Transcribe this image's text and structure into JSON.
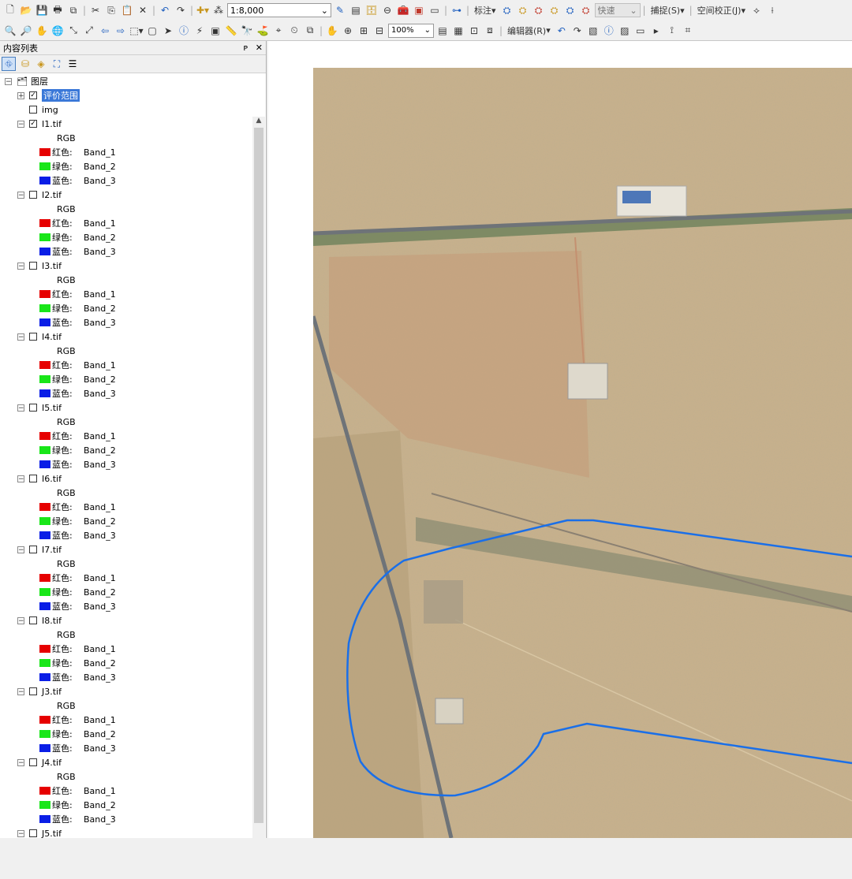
{
  "toolbar1": {
    "scale_value": "1:8,000",
    "label_menu": "标注",
    "speed_value": "快速",
    "snap_menu": "捕捉(S)",
    "georef_menu": "空间校正(J)"
  },
  "toolbar2": {
    "zoom_value": "100%",
    "editor_menu": "编辑器(R)"
  },
  "toc": {
    "title": "内容列表",
    "pin_glyph": "ᴘ",
    "close_glyph": "✕",
    "root_label": "图层",
    "items": [
      {
        "label": "评价范围",
        "checked": true,
        "selected": true,
        "expand": "+"
      },
      {
        "label": "img",
        "checked": false
      },
      {
        "label": "I1.tif",
        "checked": true,
        "expand": "−",
        "rgb": "RGB",
        "bands": [
          {
            "name": "红色:",
            "band": "Band_1"
          },
          {
            "name": "绿色:",
            "band": "Band_2"
          },
          {
            "name": "蓝色:",
            "band": "Band_3"
          }
        ]
      },
      {
        "label": "I2.tif",
        "checked": false,
        "expand": "−",
        "rgb": "RGB",
        "bands": [
          {
            "name": "红色:",
            "band": "Band_1"
          },
          {
            "name": "绿色:",
            "band": "Band_2"
          },
          {
            "name": "蓝色:",
            "band": "Band_3"
          }
        ]
      },
      {
        "label": "I3.tif",
        "checked": false,
        "expand": "−",
        "rgb": "RGB",
        "bands": [
          {
            "name": "红色:",
            "band": "Band_1"
          },
          {
            "name": "绿色:",
            "band": "Band_2"
          },
          {
            "name": "蓝色:",
            "band": "Band_3"
          }
        ]
      },
      {
        "label": "I4.tif",
        "checked": false,
        "expand": "−",
        "rgb": "RGB",
        "bands": [
          {
            "name": "红色:",
            "band": "Band_1"
          },
          {
            "name": "绿色:",
            "band": "Band_2"
          },
          {
            "name": "蓝色:",
            "band": "Band_3"
          }
        ]
      },
      {
        "label": "I5.tif",
        "checked": false,
        "expand": "−",
        "rgb": "RGB",
        "bands": [
          {
            "name": "红色:",
            "band": "Band_1"
          },
          {
            "name": "绿色:",
            "band": "Band_2"
          },
          {
            "name": "蓝色:",
            "band": "Band_3"
          }
        ]
      },
      {
        "label": "I6.tif",
        "checked": false,
        "expand": "−",
        "rgb": "RGB",
        "bands": [
          {
            "name": "红色:",
            "band": "Band_1"
          },
          {
            "name": "绿色:",
            "band": "Band_2"
          },
          {
            "name": "蓝色:",
            "band": "Band_3"
          }
        ]
      },
      {
        "label": "I7.tif",
        "checked": false,
        "expand": "−",
        "rgb": "RGB",
        "bands": [
          {
            "name": "红色:",
            "band": "Band_1"
          },
          {
            "name": "绿色:",
            "band": "Band_2"
          },
          {
            "name": "蓝色:",
            "band": "Band_3"
          }
        ]
      },
      {
        "label": "I8.tif",
        "checked": false,
        "expand": "−",
        "rgb": "RGB",
        "bands": [
          {
            "name": "红色:",
            "band": "Band_1"
          },
          {
            "name": "绿色:",
            "band": "Band_2"
          },
          {
            "name": "蓝色:",
            "band": "Band_3"
          }
        ]
      },
      {
        "label": "J3.tif",
        "checked": false,
        "expand": "−",
        "rgb": "RGB",
        "bands": [
          {
            "name": "红色:",
            "band": "Band_1"
          },
          {
            "name": "绿色:",
            "band": "Band_2"
          },
          {
            "name": "蓝色:",
            "band": "Band_3"
          }
        ]
      },
      {
        "label": "J4.tif",
        "checked": false,
        "expand": "−",
        "rgb": "RGB",
        "bands": [
          {
            "name": "红色:",
            "band": "Band_1"
          },
          {
            "name": "绿色:",
            "band": "Band_2"
          },
          {
            "name": "蓝色:",
            "band": "Band_3"
          }
        ]
      },
      {
        "label": "J5.tif",
        "checked": false,
        "expand": "−"
      }
    ]
  },
  "colors": {
    "red_band": "#e60000",
    "green_band": "#19e619",
    "blue_band": "#0a1ee6",
    "selection": "#3a78d8",
    "boundary": "#1a6fe8",
    "terrain": "#c9b28c",
    "road": "#6e7378"
  }
}
